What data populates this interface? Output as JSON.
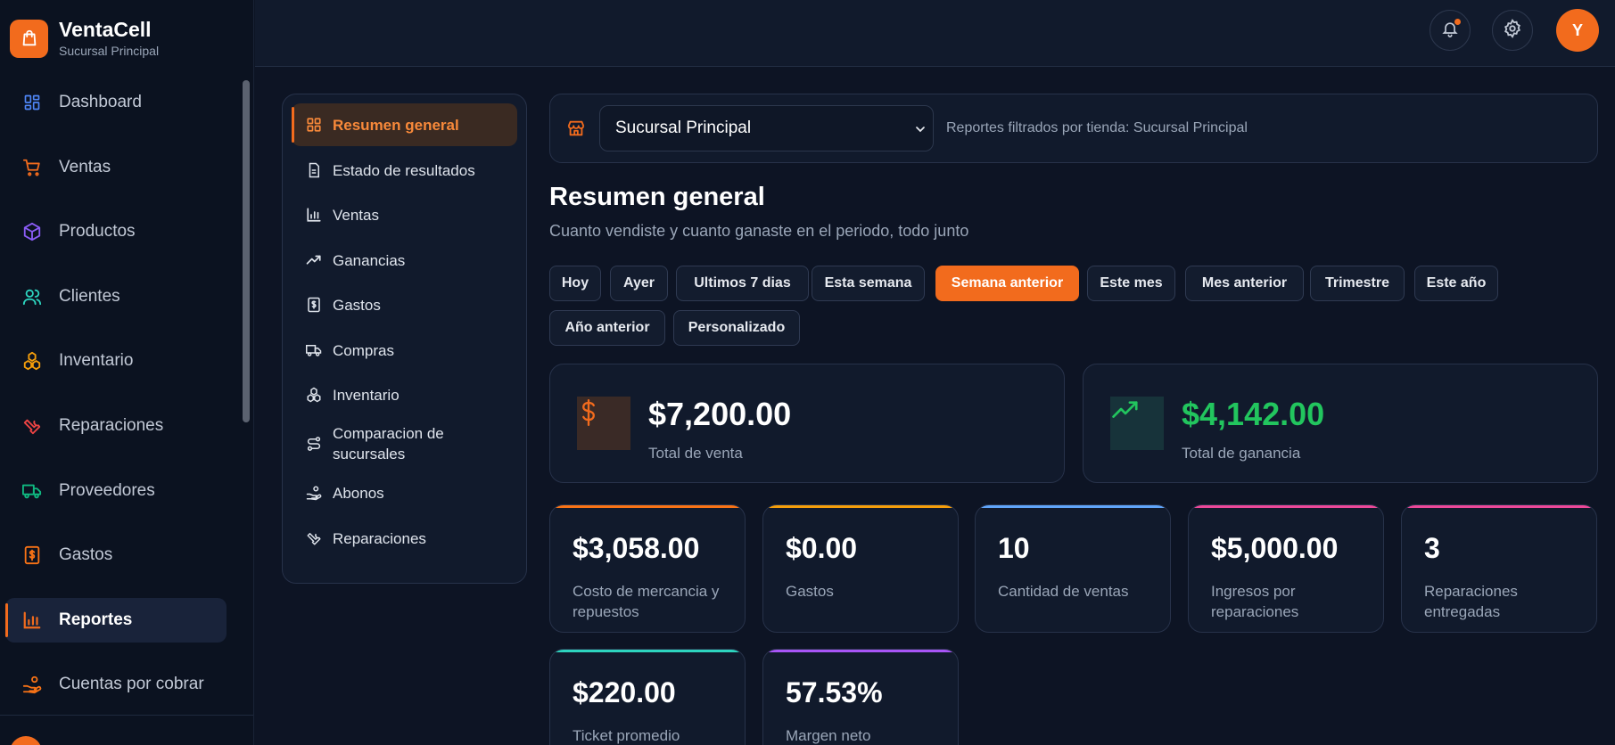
{
  "brand": {
    "name": "VentaCell",
    "subtitle": "Sucursal Principal"
  },
  "sidebar": {
    "items": [
      {
        "label": "Dashboard",
        "icon": "dashboard-grid-icon",
        "color": "#4f86f7"
      },
      {
        "label": "Ventas",
        "icon": "shopping-cart-icon",
        "color": "#f26b1d"
      },
      {
        "label": "Productos",
        "icon": "box-icon",
        "color": "#8b5cf6"
      },
      {
        "label": "Clientes",
        "icon": "users-icon",
        "color": "#2dd4bf"
      },
      {
        "label": "Inventario",
        "icon": "boxes-icon",
        "color": "#f59e0b"
      },
      {
        "label": "Reparaciones",
        "icon": "wrench-icon",
        "color": "#ef4444"
      },
      {
        "label": "Proveedores",
        "icon": "truck-icon",
        "color": "#10b981"
      },
      {
        "label": "Gastos",
        "icon": "receipt-dollar-icon",
        "color": "#f97316"
      },
      {
        "label": "Reportes",
        "icon": "bar-chart-icon",
        "color": "#f26b1d",
        "active": true
      },
      {
        "label": "Cuentas por cobrar",
        "icon": "hand-coins-icon",
        "color": "#f97316"
      }
    ]
  },
  "topbar": {
    "avatar_initial": "Y",
    "notification_icon": "bell-icon",
    "settings_icon": "gear-icon"
  },
  "report_nav": {
    "items": [
      {
        "label": "Resumen general",
        "icon": "grid-icon",
        "active": true
      },
      {
        "label": "Estado de resultados",
        "icon": "document-icon"
      },
      {
        "label": "Ventas",
        "icon": "bar-chart-icon"
      },
      {
        "label": "Ganancias",
        "icon": "trending-up-icon"
      },
      {
        "label": "Gastos",
        "icon": "receipt-dollar-icon"
      },
      {
        "label": "Compras",
        "icon": "truck-icon"
      },
      {
        "label": "Inventario",
        "icon": "boxes-icon"
      },
      {
        "label": "Comparacion de sucursales",
        "icon": "route-icon"
      },
      {
        "label": "Abonos",
        "icon": "hand-coins-icon"
      },
      {
        "label": "Reparaciones",
        "icon": "wrench-icon"
      }
    ]
  },
  "store_filter": {
    "selected": "Sucursal Principal",
    "note": "Reportes filtrados por tienda: Sucursal Principal"
  },
  "page": {
    "title": "Resumen general",
    "subtitle": "Cuanto vendiste y cuanto ganaste en el periodo, todo junto"
  },
  "periods": [
    {
      "label": "Hoy"
    },
    {
      "label": "Ayer"
    },
    {
      "label": "Ultimos 7 dias"
    },
    {
      "label": "Esta semana"
    },
    {
      "label": "Semana anterior",
      "active": true
    },
    {
      "label": "Este mes"
    },
    {
      "label": "Mes anterior"
    },
    {
      "label": "Trimestre"
    },
    {
      "label": "Este año"
    },
    {
      "label": "Año anterior"
    },
    {
      "label": "Personalizado"
    }
  ],
  "summary": {
    "sales": {
      "value": "$7,200.00",
      "label": "Total de venta",
      "color": "#ffffff",
      "icon": "dollar-icon"
    },
    "profit": {
      "value": "$4,142.00",
      "label": "Total de ganancia",
      "color": "#22c55e",
      "icon": "trending-up-icon"
    }
  },
  "stats": [
    {
      "value": "$3,058.00",
      "label": "Costo de mercancia y repuestos",
      "accent": "#f97316"
    },
    {
      "value": "$0.00",
      "label": "Gastos",
      "accent": "#f59e0b"
    },
    {
      "value": "10",
      "label": "Cantidad de ventas",
      "accent": "#60a5fa"
    },
    {
      "value": "$5,000.00",
      "label": "Ingresos por reparaciones",
      "accent": "#ec4899"
    },
    {
      "value": "3",
      "label": "Reparaciones entregadas",
      "accent": "#ec4899"
    },
    {
      "value": "$220.00",
      "label": "Ticket promedio (ventas)",
      "accent": "#2dd4bf"
    },
    {
      "value": "57.53%",
      "label": "Margen neto",
      "accent": "#a855f7"
    }
  ]
}
